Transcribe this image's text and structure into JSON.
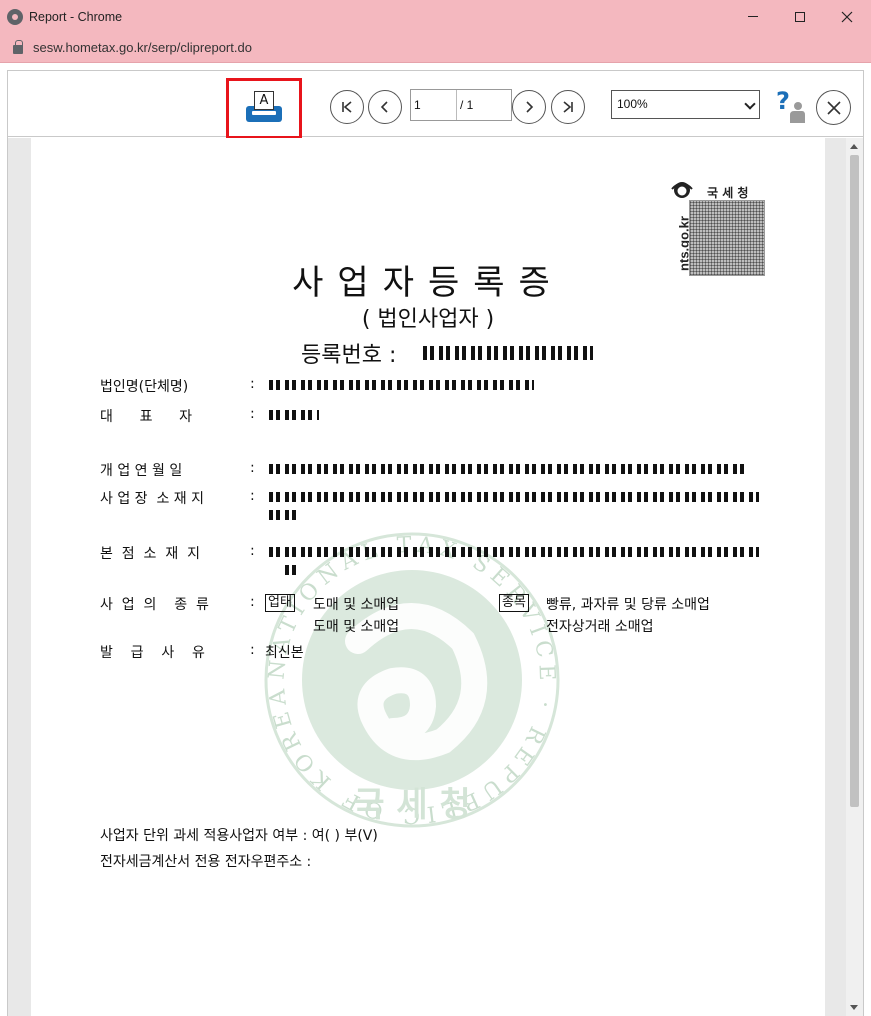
{
  "window": {
    "title": "Report - Chrome",
    "url": "sesw.hometax.go.kr/serp/clipreport.do"
  },
  "toolbar": {
    "print_glyph": "A",
    "page_current": "1",
    "page_total": "/ 1",
    "zoom_value": "100%",
    "help_glyph": "?"
  },
  "document": {
    "nts_title": "국 세 청",
    "nts_url": "nts.go.kr",
    "title": "사업자등록증",
    "subtitle": "( 법인사업자 )",
    "reg_no_label": "등록번호 :",
    "fields": {
      "corp_name_label": "법인명(단체명)",
      "rep_label": "대      표      자",
      "open_date_label": "개 업 연 월 일",
      "location_label": "사 업 장  소 재 지",
      "hq_label": "본  점  소  재  지",
      "business_type_label": "사  업  의    종  류",
      "issue_reason_label": "발    급    사    유",
      "colon": ":"
    },
    "business": {
      "type_badge": "업태",
      "type_value_1": "도매 및 소매업",
      "type_value_2": "도매 및 소매업",
      "item_badge": "종목",
      "item_value_1": "빵류, 과자류 및 당류 소매업",
      "item_value_2": "전자상거래 소매업"
    },
    "issue_reason": "최신본",
    "unit_tax_line": "사업자 단위 과세 적용사업자 여부  :  여(   ) 부(V)",
    "e_invoice_line": "전자세금계산서 전용 전자우편주소  :",
    "seal_center_text": "국 세 청",
    "seal_ring_text": "NATIONAL TAX SERVICE · REPUBLIC OF KOREA"
  },
  "colors": {
    "titlebar": "#f4b8bf",
    "print_highlight": "#e8141b",
    "printer_blue": "#1b6fb8",
    "seal_green": "#2e8b4e"
  }
}
